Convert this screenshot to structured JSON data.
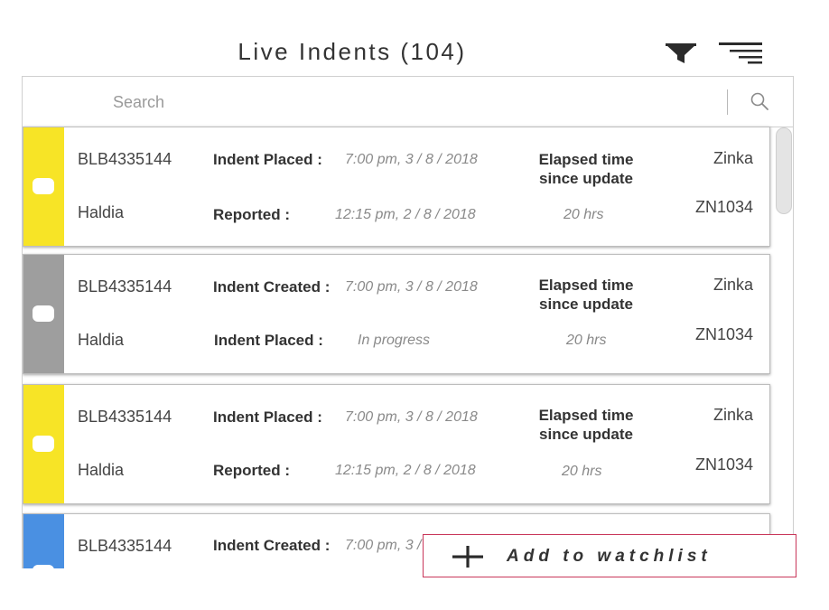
{
  "header": {
    "title": "Live Indents (104)",
    "filter_icon": "filter-icon",
    "menu_icon": "menu-sort-icon"
  },
  "search": {
    "placeholder": "Search",
    "icon": "search-icon"
  },
  "cards": [
    {
      "status_color": "#f7e426",
      "indent_id": "BLB4335144",
      "location": "Haldia",
      "row1_label": "Indent Placed :",
      "row1_value": "7:00 pm, 3 / 8 / 2018",
      "row2_label": "Reported  :",
      "row2_value": "12:15 pm, 2 / 8 / 2018",
      "elapsed_label_1": "Elapsed time",
      "elapsed_label_2": "since update",
      "elapsed_value": "20 hrs",
      "company": "Zinka",
      "code": "ZN1034"
    },
    {
      "status_color": "#9e9e9e",
      "indent_id": "BLB4335144",
      "location": "Haldia",
      "row1_label": "Indent Created :",
      "row1_value": "7:00 pm, 3 / 8 / 2018",
      "row2_label": "Indent Placed  :",
      "row2_value": "In progress",
      "elapsed_label_1": "Elapsed time",
      "elapsed_label_2": "since update",
      "elapsed_value": "20 hrs",
      "company": "Zinka",
      "code": "ZN1034"
    },
    {
      "status_color": "#f7e426",
      "indent_id": "BLB4335144",
      "location": "Haldia",
      "row1_label": "Indent Placed :",
      "row1_value": "7:00 pm, 3 / 8 / 2018",
      "row2_label": "Reported  :",
      "row2_value": "12:15 pm, 2 / 8 / 2018",
      "elapsed_label_1": "Elapsed time",
      "elapsed_label_2": "since update",
      "elapsed_value": "20 hrs",
      "company": "Zinka",
      "code": "ZN1034"
    },
    {
      "status_color": "#4a90e2",
      "indent_id": "BLB4335144",
      "row1_label": "Indent Created :",
      "row1_value": "7:00 pm, 3 /"
    }
  ],
  "watchlist": {
    "label": "Add to watchlist",
    "icon": "plus-icon"
  }
}
